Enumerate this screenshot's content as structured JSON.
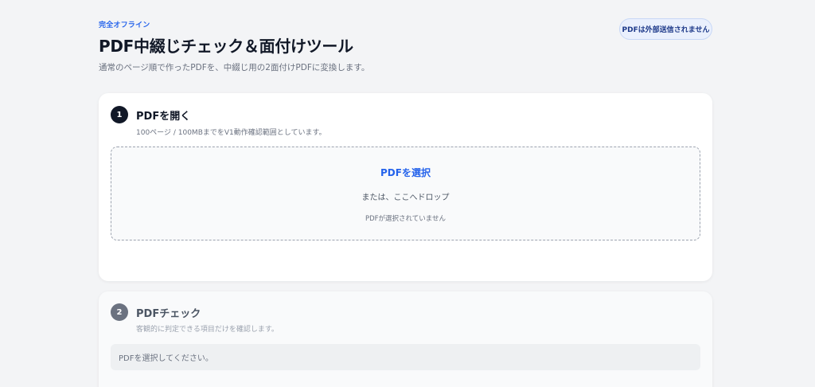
{
  "header": {
    "eyebrow": "完全オフライン",
    "title": "PDF中綴じチェック＆面付けツール",
    "subtitle": "通常のページ順で作ったPDFを、中綴じ用の2面付けPDFに変換します。",
    "offline_badge": "PDFは外部送信されません"
  },
  "steps": [
    {
      "number": "1",
      "title": "PDFを開く",
      "description": "100ページ / 100MBまでをV1動作確認範囲としています。",
      "dropzone": {
        "select_label": "PDFを選択",
        "drop_hint": "または、ここへドロップ",
        "status": "PDFが選択されていません"
      }
    },
    {
      "number": "2",
      "title": "PDFチェック",
      "description": "客観的に判定できる項目だけを確認します。",
      "placeholder_message": "PDFを選択してください。"
    }
  ],
  "colors": {
    "accent": "#2563eb",
    "background": "#f3f4f6",
    "step_active": "#111827",
    "step_inactive": "#6b7280"
  }
}
